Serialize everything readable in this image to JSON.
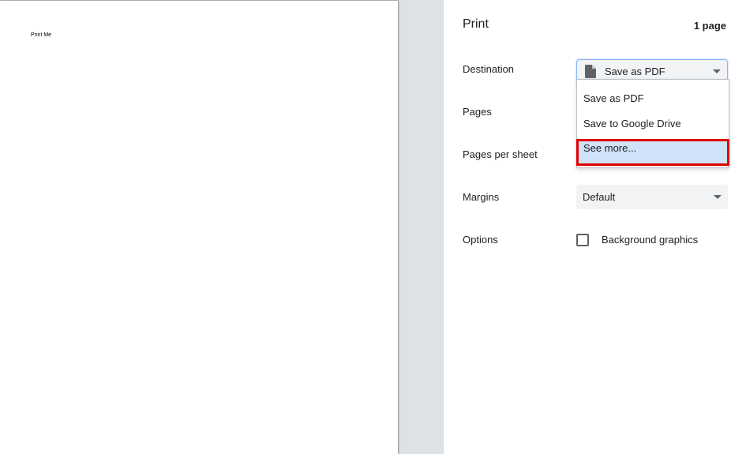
{
  "preview": {
    "page_text": "Print Me"
  },
  "sidebar": {
    "title": "Print",
    "page_count": "1 page",
    "destination": {
      "label": "Destination",
      "selected": "Save as PDF",
      "icon": "document-icon",
      "options": [
        "Save as PDF",
        "Save to Google Drive",
        "See more..."
      ]
    },
    "pages": {
      "label": "Pages"
    },
    "pages_per_sheet": {
      "label": "Pages per sheet"
    },
    "margins": {
      "label": "Margins",
      "selected": "Default"
    },
    "options": {
      "label": "Options",
      "background_graphics": {
        "label": "Background graphics",
        "checked": false
      }
    }
  },
  "colors": {
    "accent": "#8ab4f8",
    "highlight": "#cfe2f8",
    "annotation_box": "#e00000"
  }
}
